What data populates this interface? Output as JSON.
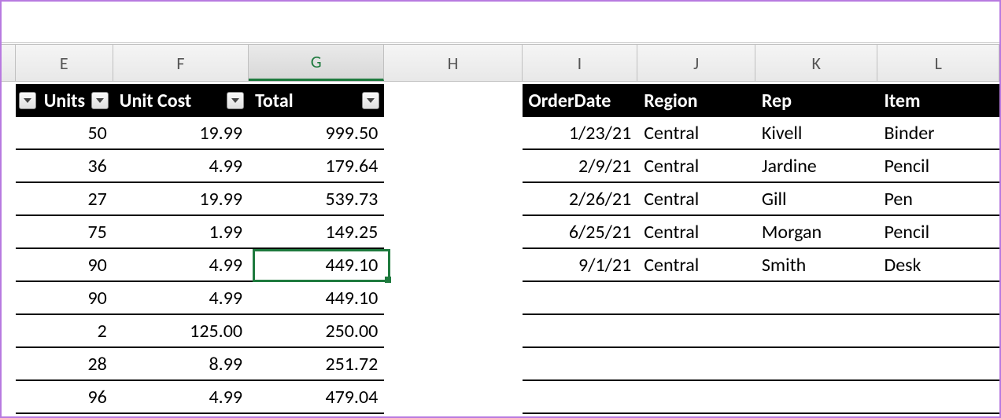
{
  "columns": [
    "E",
    "F",
    "G",
    "H",
    "I",
    "J",
    "K",
    "L"
  ],
  "activeColumn": "G",
  "leftTable": {
    "headers": [
      "Units",
      "Unit Cost",
      "Total"
    ],
    "rows": [
      {
        "units": "50",
        "cost": "19.99",
        "total": "999.50"
      },
      {
        "units": "36",
        "cost": "4.99",
        "total": "179.64"
      },
      {
        "units": "27",
        "cost": "19.99",
        "total": "539.73"
      },
      {
        "units": "75",
        "cost": "1.99",
        "total": "149.25"
      },
      {
        "units": "90",
        "cost": "4.99",
        "total": "449.10"
      },
      {
        "units": "90",
        "cost": "4.99",
        "total": "449.10"
      },
      {
        "units": "2",
        "cost": "125.00",
        "total": "250.00"
      },
      {
        "units": "28",
        "cost": "8.99",
        "total": "251.72"
      },
      {
        "units": "96",
        "cost": "4.99",
        "total": "479.04"
      }
    ]
  },
  "rightTable": {
    "headers": [
      "OrderDate",
      "Region",
      "Rep",
      "Item"
    ],
    "rows": [
      {
        "date": "1/23/21",
        "region": "Central",
        "rep": "Kivell",
        "item": "Binder"
      },
      {
        "date": "2/9/21",
        "region": "Central",
        "rep": "Jardine",
        "item": "Pencil"
      },
      {
        "date": "2/26/21",
        "region": "Central",
        "rep": "Gill",
        "item": "Pen"
      },
      {
        "date": "6/25/21",
        "region": "Central",
        "rep": "Morgan",
        "item": "Pencil"
      },
      {
        "date": "9/1/21",
        "region": "Central",
        "rep": "Smith",
        "item": "Desk"
      },
      {
        "date": "",
        "region": "",
        "rep": "",
        "item": ""
      },
      {
        "date": "",
        "region": "",
        "rep": "",
        "item": ""
      },
      {
        "date": "",
        "region": "",
        "rep": "",
        "item": ""
      },
      {
        "date": "",
        "region": "",
        "rep": "",
        "item": ""
      }
    ]
  },
  "selectedCell": {
    "col": "G",
    "rowIndex": 4
  }
}
